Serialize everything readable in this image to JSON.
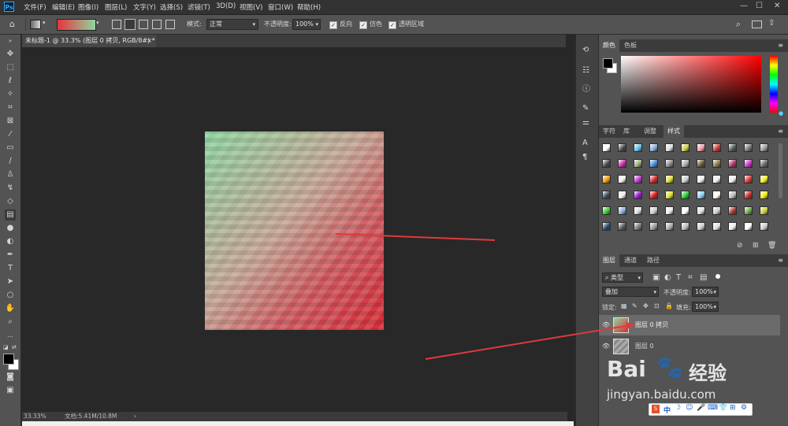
{
  "menu": {
    "logo": "Ps",
    "items": [
      "文件(F)",
      "编辑(E)",
      "图像(I)",
      "图层(L)",
      "文字(Y)",
      "选择(S)",
      "滤镜(T)",
      "3D(D)",
      "视图(V)",
      "窗口(W)",
      "帮助(H)"
    ]
  },
  "window_controls": {
    "minimize": "—",
    "maximize": "☐",
    "close": "✕"
  },
  "options": {
    "mode_label": "模式:",
    "mode_value": "正常",
    "opacity_label": "不透明度:",
    "opacity_value": "100%",
    "reverse_label": "反向",
    "dither_label": "仿色",
    "transparency_label": "透明区域",
    "gradient_colors": [
      "#e8323c",
      "#8fd6a0"
    ]
  },
  "document": {
    "tab_title": "未标题-1 @ 33.3% (图层 0 拷贝, RGB/8#) *",
    "close": "×",
    "zoom": "33.33%",
    "doc_size": "文档:5.41M/10.8M",
    "arrow": "›"
  },
  "color_panel": {
    "tabs": [
      "颜色",
      "色板"
    ],
    "foreground": "#000000",
    "background": "#ffffff",
    "hue": "#ff0000"
  },
  "styles_panel": {
    "tabs": [
      "字符",
      "库",
      "调整",
      "样式"
    ]
  },
  "layers_panel": {
    "tabs": [
      "图层",
      "通道",
      "路径"
    ],
    "filter_kind": "类型",
    "blend_mode": "叠加",
    "opacity_label": "不透明度:",
    "opacity_value": "100%",
    "lock_label": "锁定:",
    "fill_label": "填充:",
    "fill_value": "100%",
    "layers": [
      {
        "name": "图层 0 拷贝",
        "selected": true
      },
      {
        "name": "图层 0",
        "selected": false
      }
    ]
  },
  "watermark": {
    "logo_text": "Bai",
    "logo_text2": "经验",
    "url": "jingyan.baidu.com"
  },
  "ime_bar": {
    "label": "中"
  }
}
